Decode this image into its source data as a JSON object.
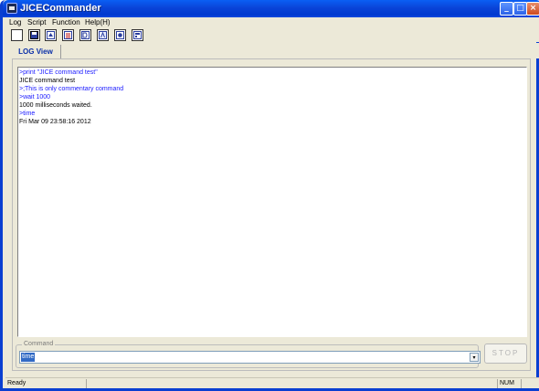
{
  "window": {
    "title": "JICECommander"
  },
  "titlebar": {
    "minimize_glyph": "_",
    "maximize_glyph": "□",
    "close_glyph": "×"
  },
  "menu": {
    "items": [
      "Log",
      "Script",
      "Function",
      "Help(H)"
    ]
  },
  "toolbar": {
    "icons": [
      "new-icon",
      "save-icon",
      "export-icon",
      "list-icon",
      "document-icon",
      "text-icon",
      "record-icon",
      "window-icon"
    ]
  },
  "tabs": [
    {
      "label": "LOG View"
    }
  ],
  "log": {
    "lines": [
      {
        "text": ">print \"JICE command test\"",
        "kind": "cmd"
      },
      {
        "text": "JICE command test",
        "kind": "out"
      },
      {
        "text": ">;This is only commentary command",
        "kind": "cmd"
      },
      {
        "text": ">wait 1000",
        "kind": "cmd"
      },
      {
        "text": "1000 milliseconds waited.",
        "kind": "out"
      },
      {
        "text": ">time",
        "kind": "cmd"
      },
      {
        "text": "Fri Mar 09 23:58:16 2012",
        "kind": "out"
      }
    ]
  },
  "command": {
    "legend": "Command",
    "value": "time",
    "dropdown_glyph": "▾"
  },
  "stop_button": {
    "label": "STOP"
  },
  "status": {
    "text": "Ready",
    "num": "NUM"
  },
  "colors": {
    "title_bar": "#0a44d8",
    "cmd_text": "#1a1aff",
    "selection": "#316ac5",
    "tab_text": "#0a2fa8"
  }
}
